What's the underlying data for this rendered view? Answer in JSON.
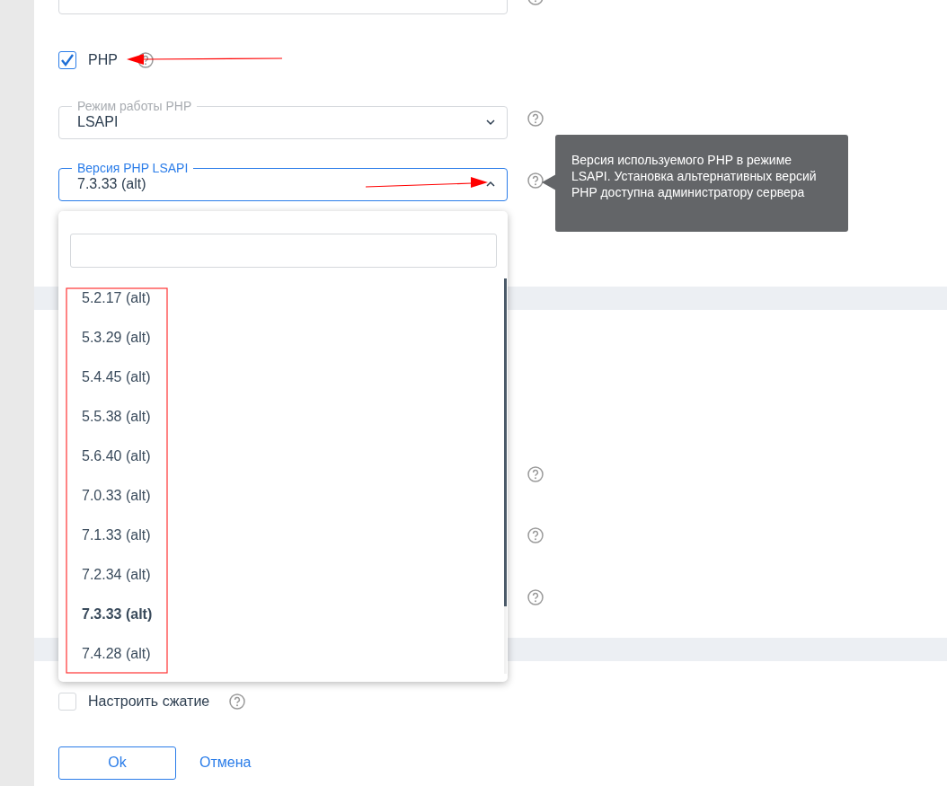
{
  "php": {
    "label": "PHP",
    "checked": true
  },
  "mode_field": {
    "label": "Режим работы PHP",
    "value": "LSAPI",
    "expanded": false
  },
  "version_field": {
    "label": "Версия PHP LSAPI",
    "value": "7.3.33 (alt)",
    "expanded": true
  },
  "tooltip": {
    "text": "Версия используемого PHP в режиме LSAPI. Установка альтернативных версий PHP доступна администратору сервера"
  },
  "options": [
    {
      "label": "5.2.17 (alt)",
      "selected": false
    },
    {
      "label": "5.3.29 (alt)",
      "selected": false
    },
    {
      "label": "5.4.45 (alt)",
      "selected": false
    },
    {
      "label": "5.5.38 (alt)",
      "selected": false
    },
    {
      "label": "5.6.40 (alt)",
      "selected": false
    },
    {
      "label": "7.0.33 (alt)",
      "selected": false
    },
    {
      "label": "7.1.33 (alt)",
      "selected": false
    },
    {
      "label": "7.2.34 (alt)",
      "selected": false
    },
    {
      "label": "7.3.33 (alt)",
      "selected": true
    },
    {
      "label": "7.4.28 (alt)",
      "selected": false
    }
  ],
  "compress": {
    "label": "Настроить сжатие",
    "checked": false
  },
  "buttons": {
    "ok": "Ok",
    "cancel": "Отмена"
  }
}
